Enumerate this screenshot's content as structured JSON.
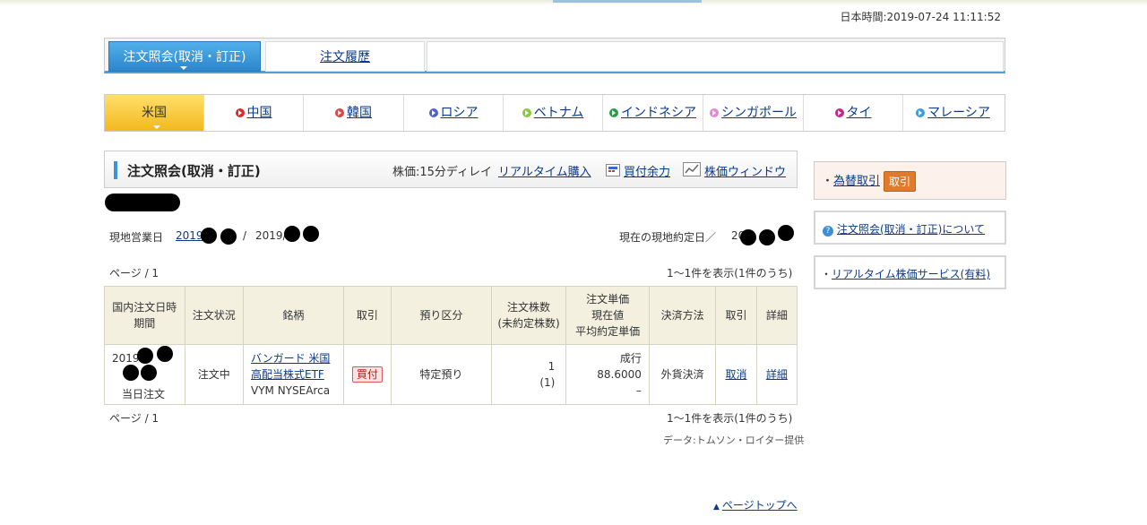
{
  "clock": "日本時間:2019-07-24 11:11:52",
  "top_tabs": [
    {
      "label": "注文照会(取消・訂正)",
      "active": true
    },
    {
      "label": "注文履歴",
      "active": false
    }
  ],
  "markets": [
    {
      "label": "米国",
      "active": true
    },
    {
      "label": "中国",
      "color": "#e02a2a"
    },
    {
      "label": "韓国",
      "color": "#d64a4a"
    },
    {
      "label": "ロシア",
      "color": "#5060d0"
    },
    {
      "label": "ベトナム",
      "color": "#8cc83c"
    },
    {
      "label": "インドネシア",
      "color": "#2c9a4a"
    },
    {
      "label": "シンガポール",
      "color": "#e08ad0"
    },
    {
      "label": "タイ",
      "color": "#c02a8a"
    },
    {
      "label": "マレーシア",
      "color": "#3aa0d8"
    }
  ],
  "section": {
    "title": "注文照会(取消・訂正)",
    "delay_text": "株価:15分ディレイ",
    "realtime_link": "リアルタイム購入",
    "buying_power_link": "買付余力",
    "price_window_link": "株価ウィンドウ"
  },
  "dates": {
    "local_business_day_label": "現地営業日",
    "local_business_day_prefix": "2019",
    "local_business_day_mid": "/",
    "local_business_day_second": "2019/",
    "current_settlement_label": "現在の現地約定日／",
    "current_settlement_prefix": "20"
  },
  "pagination": {
    "page_label": "ページ / 1",
    "count_label": "1〜1件を表示(1件のうち)"
  },
  "table": {
    "headers": [
      "国内注文日時\n期間",
      "注文状況",
      "銘柄",
      "取引",
      "預り区分",
      "注文株数\n(未約定株数)",
      "注文単価\n現在値\n平均約定単価",
      "決済方法",
      "取引",
      "詳細"
    ],
    "rows": [
      {
        "date_prefix": "2019",
        "period": "当日注文",
        "status": "注文中",
        "name_link": "バンガード 米国\n高配当株式ETF",
        "ticker": "VYM NYSEArca",
        "side": "買付",
        "account": "特定預り",
        "shares": "1",
        "unfilled": "(1)",
        "order_type": "成行",
        "current_price": "88.6000",
        "avg_price": "–",
        "settlement": "外貨決済",
        "action": "取消",
        "detail": "詳細"
      }
    ]
  },
  "data_credit": "データ:トムソン・ロイター提供",
  "page_top": "ページトップへ",
  "sidebar": {
    "fx_link": "為替取引",
    "fx_button": "取引",
    "about_link": "注文照会(取消・訂正)について",
    "realtime_service_link": "リアルタイム株価サービス(有料)"
  }
}
